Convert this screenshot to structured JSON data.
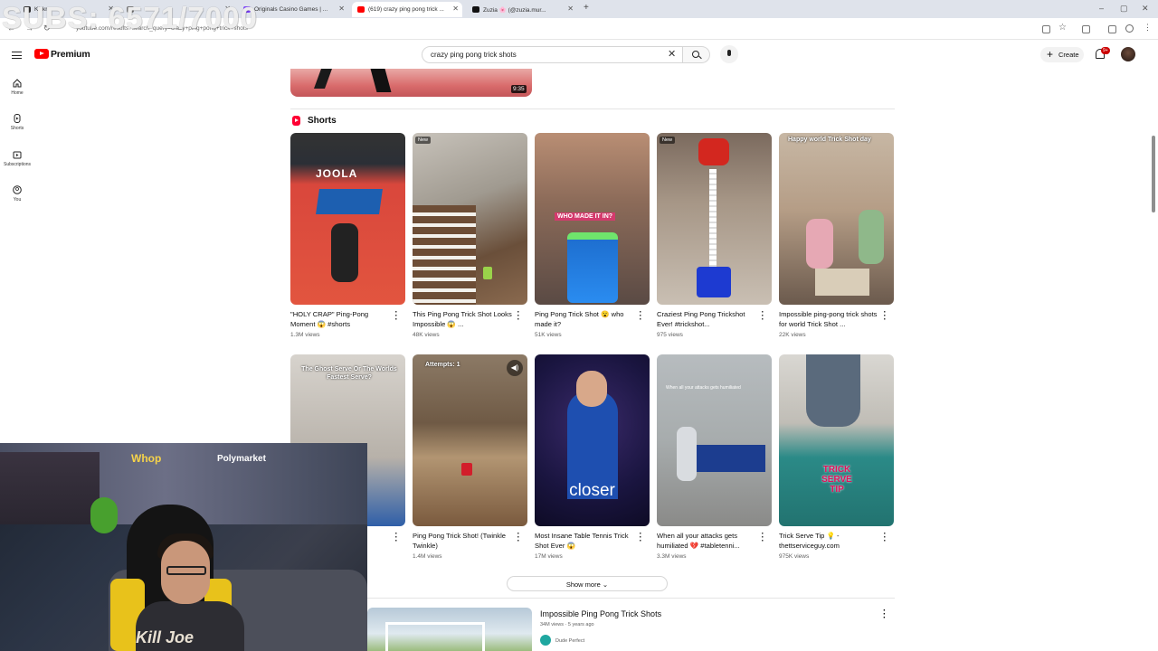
{
  "overlay": {
    "subs": "SUBS: 6571/7000"
  },
  "browser": {
    "tabs": [
      {
        "label": "Kickr"
      },
      {
        "label": ""
      },
      {
        "label": "Originals Casino Games | ..."
      },
      {
        "label": "(619) crazy ping pong trick ..."
      },
      {
        "label": "Zuzia 🌸 (@zuzia.mur..."
      }
    ],
    "url": "youtube.com/results?search_query=crazy+ping+pong+trick+shots"
  },
  "header": {
    "brand": "Premium",
    "search_value": "crazy ping pong trick shots",
    "create_label": "Create",
    "notif_badge": "9+"
  },
  "sidebar": {
    "items": [
      {
        "label": "Home",
        "icon": "home-icon"
      },
      {
        "label": "Shorts",
        "icon": "shorts-icon"
      },
      {
        "label": "Subscriptions",
        "icon": "subscriptions-icon"
      },
      {
        "label": "You",
        "icon": "you-icon"
      }
    ]
  },
  "prev_video": {
    "duration": "9:35"
  },
  "shorts": {
    "section_title": "Shorts",
    "items": [
      {
        "title": "\"HOLY CRAP\" Ping-Pong Moment 😱 #shorts",
        "views": "1.3M views",
        "badge": "",
        "caption": "JOOLA"
      },
      {
        "title": "This Ping Pong Trick Shot Looks Impossible 😱 ...",
        "views": "48K views",
        "badge": "New",
        "caption": ""
      },
      {
        "title": "Ping Pong Trick Shot 😮 who made it?",
        "views": "51K views",
        "badge": "",
        "caption": "WHO MADE IT IN?"
      },
      {
        "title": "Craziest Ping Pong Trickshot Ever! #trickshot...",
        "views": "975 views",
        "badge": "New",
        "caption": ""
      },
      {
        "title": "Impossible ping-pong trick shots for world Trick Shot ...",
        "views": "22K views",
        "badge": "",
        "caption": "Happy world Trick Shot day"
      },
      {
        "title": "",
        "views": "",
        "badge": "",
        "caption": "The Ghost Serve Or The Worlds Fastest Serve?"
      },
      {
        "title": "Ping Pong Trick Shot! (Twinkle Twinkle)",
        "views": "1.4M views",
        "badge": "",
        "caption": "Attempts: 1"
      },
      {
        "title": "Most Insane Table Tennis Trick Shot Ever 😱",
        "views": "17M views",
        "badge": "",
        "caption": "closer"
      },
      {
        "title": "When all your attacks gets humiliated 💔 #tabletenni...",
        "views": "3.3M views",
        "badge": "",
        "caption": "When all your attacks gets humiliated"
      },
      {
        "title": "Trick Serve Tip 💡 - thettserviceguy.com",
        "views": "975K views",
        "badge": "",
        "caption": "TRICK SERVE TIP"
      }
    ],
    "show_more": "Show more"
  },
  "next_video": {
    "title": "Impossible Ping Pong Trick Shots",
    "meta": "34M views · 5 years ago",
    "channel": "Dude Perfect"
  },
  "cam": {
    "whop": "Whop",
    "polymarket": "Polymarket",
    "wall_text": "Kill Joe"
  },
  "colors": {
    "accent": "#ff0000",
    "badge": "#cc0000"
  }
}
